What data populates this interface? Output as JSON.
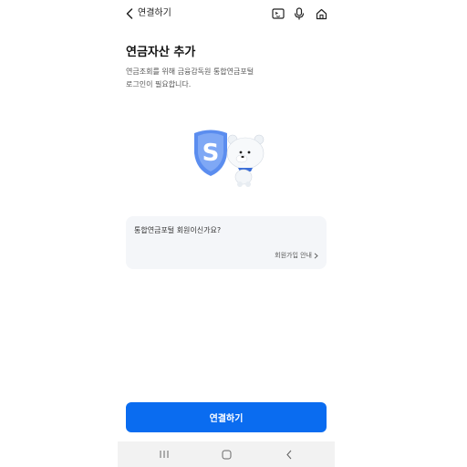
{
  "header": {
    "title": "연결하기",
    "icons": [
      "back-icon",
      "chat-icon",
      "microphone-icon",
      "home-icon"
    ]
  },
  "main": {
    "title": "연금자산 추가",
    "description_lines": [
      "연금조회를 위해 금융감독원 통합연금포털",
      "로그인이 필요합니다."
    ],
    "card": {
      "question": "통합연금포털 회원이신가요?",
      "signup_link": "회원가입 안내"
    },
    "illustration_letter": "S",
    "primary_button": "연결하기"
  },
  "nav_bar": {
    "icons": [
      "recent-apps-icon",
      "home-button-icon",
      "back-nav-icon"
    ]
  },
  "colors": {
    "accent": "#0a6cf0",
    "card_bg": "#f4f6f9",
    "shield": "#5b8def"
  }
}
